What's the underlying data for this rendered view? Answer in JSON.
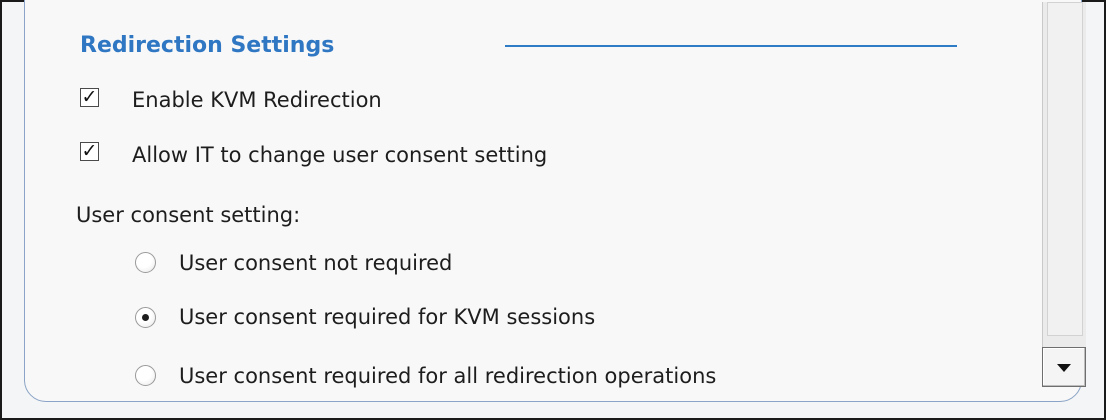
{
  "section": {
    "title": "Redirection Settings"
  },
  "checkboxes": [
    {
      "label": "Enable KVM Redirection",
      "checked": true
    },
    {
      "label": "Allow IT to change user consent setting",
      "checked": true
    }
  ],
  "consent": {
    "heading": "User consent setting:",
    "options": [
      {
        "label": "User consent not required",
        "selected": false
      },
      {
        "label": "User consent required for KVM sessions",
        "selected": true
      },
      {
        "label": "User consent required for all redirection operations",
        "selected": false
      }
    ]
  },
  "scrollbar": {
    "down_icon": "chevron-down-icon"
  },
  "colors": {
    "section_title": "#2f77c3",
    "panel_border": "#8aa3c6"
  }
}
